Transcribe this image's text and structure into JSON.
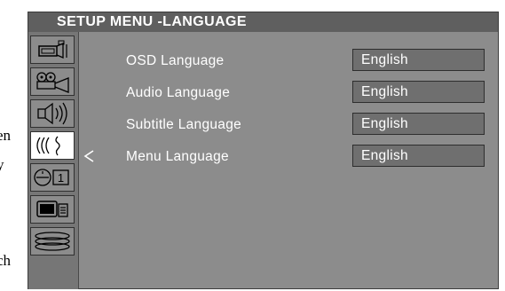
{
  "background_text": [
    "en",
    "y",
    "ch"
  ],
  "menu": {
    "title": "SETUP MENU -LANGUAGE",
    "sidebar": [
      {
        "icon": "camera-angle-icon",
        "active": false
      },
      {
        "icon": "projector-icon",
        "active": false
      },
      {
        "icon": "speaker-icon",
        "active": false
      },
      {
        "icon": "language-icon",
        "active": true
      },
      {
        "icon": "timer-icon",
        "active": false
      },
      {
        "icon": "display-icon",
        "active": false
      },
      {
        "icon": "disc-stack-icon",
        "active": false
      }
    ],
    "rows": [
      {
        "label": "OSD Language",
        "value": "English"
      },
      {
        "label": "Audio Language",
        "value": "English"
      },
      {
        "label": "Subtitle Language",
        "value": "English"
      },
      {
        "label": "Menu Language",
        "value": "English"
      }
    ],
    "selected_row": "Menu Language",
    "timer_digit": "1",
    "colors": {
      "panel": "#8c8c8c",
      "title_bar": "#5f5f5f",
      "value_box": "#6f6f6f",
      "text": "#ffffff"
    }
  }
}
